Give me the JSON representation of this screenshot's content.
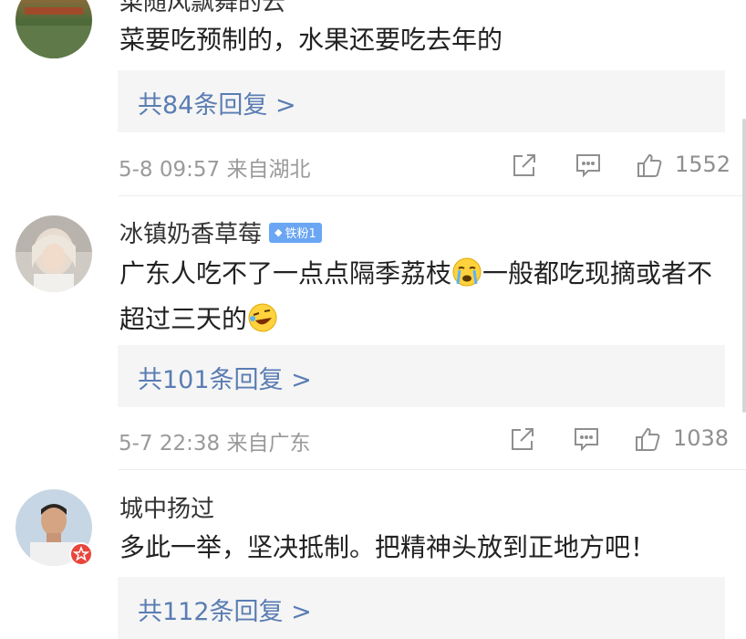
{
  "comments": [
    {
      "username": "菜随风飘舞的云",
      "text": "菜要吃预制的，水果还要吃去年的",
      "replies_label": "共84条回复 >",
      "time": "5-8 09:57",
      "location": "来自湖北",
      "likes": "1552"
    },
    {
      "username": "冰镇奶香草莓",
      "badge": "铁粉1",
      "text_part1": "广东人吃不了一点点隔季荔枝",
      "text_part2": "一般都吃现摘或者不超过三天的",
      "replies_label": "共101条回复 >",
      "time": "5-7 22:38",
      "location": "来自广东",
      "likes": "1038"
    },
    {
      "username": "城中扬过",
      "text": "多此一举，坚决抵制。把精神头放到正地方吧！",
      "replies_label": "共112条回复 >"
    }
  ],
  "icons": {
    "share": "share-icon",
    "comment": "comment-icon",
    "like": "thumbs-up-icon",
    "crying": "crying-emoji-icon",
    "laughing": "laughing-emoji-icon",
    "verified": "verified-badge-icon"
  },
  "colors": {
    "reply_link": "#5a7db2",
    "meta_gray": "#9a9a9a",
    "badge_blue": "#6aa6f3",
    "verified_red": "#e8453c"
  }
}
